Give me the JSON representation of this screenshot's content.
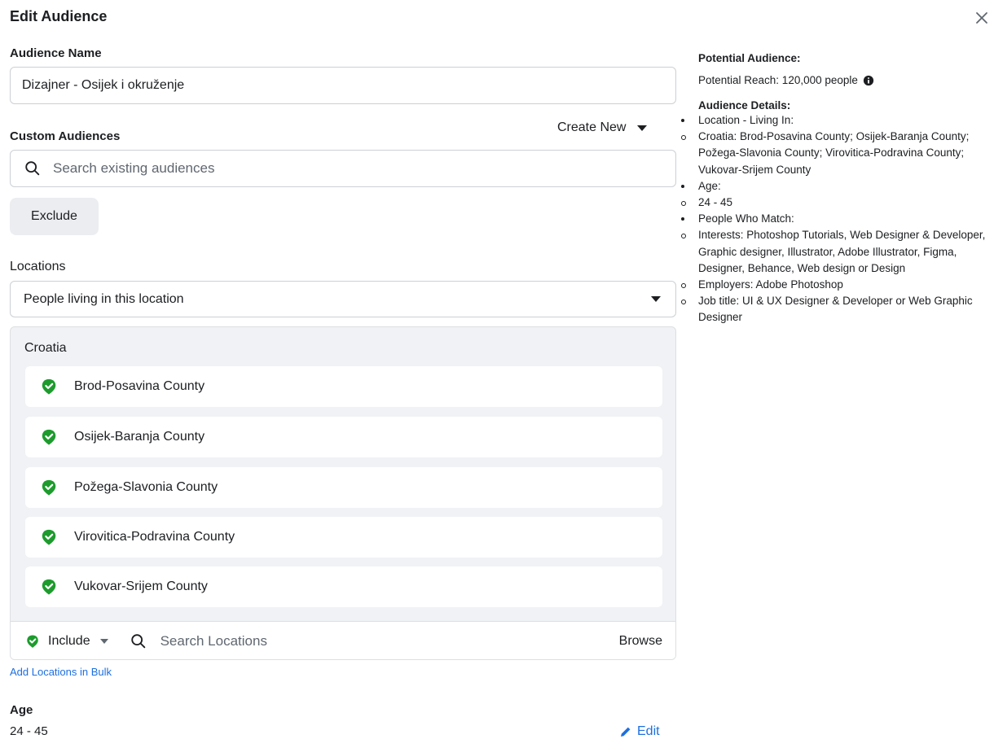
{
  "dialog": {
    "title": "Edit Audience",
    "close_icon": "close-icon"
  },
  "audience_name": {
    "label": "Audience Name",
    "value": "Dizajner - Osijek i okruženje"
  },
  "custom_audiences": {
    "label": "Custom Audiences",
    "create_new": "Create New",
    "search_placeholder": "Search existing audiences",
    "exclude_label": "Exclude"
  },
  "locations": {
    "label": "Locations",
    "selected_mode": "People living in this location",
    "country": "Croatia",
    "items": [
      {
        "name": "Brod-Posavina County"
      },
      {
        "name": "Osijek-Baranja County"
      },
      {
        "name": "Požega-Slavonia County"
      },
      {
        "name": "Virovitica-Podravina County"
      },
      {
        "name": "Vukovar-Srijem County"
      }
    ],
    "include_label": "Include",
    "search_placeholder": "Search Locations",
    "browse_label": "Browse",
    "bulk_link": "Add Locations in Bulk"
  },
  "age": {
    "label": "Age",
    "value": "24 - 45",
    "edit_label": "Edit"
  },
  "summary": {
    "potential_heading": "Potential Audience:",
    "potential_reach": "Potential Reach: 120,000 people",
    "details_heading": "Audience Details:",
    "details": [
      {
        "level": 1,
        "text": "Location - Living In:"
      },
      {
        "level": 2,
        "text": "Croatia: Brod-Posavina County; Osijek-Baranja County; Požega-Slavonia County; Virovitica-Podravina County; Vukovar-Srijem County"
      },
      {
        "level": 1,
        "text": "Age:"
      },
      {
        "level": 2,
        "text": "24 - 45"
      },
      {
        "level": 1,
        "text": "People Who Match:"
      },
      {
        "level": 2,
        "text": "Interests: Photoshop Tutorials, Web Designer & Developer, Graphic designer, Illustrator, Adobe Illustrator, Figma, Designer, Behance, Web design or Design"
      },
      {
        "level": 2,
        "text": "Employers: Adobe Photoshop"
      },
      {
        "level": 2,
        "text": "Job title: UI & UX Designer & Developer or Web Graphic Designer"
      }
    ]
  },
  "colors": {
    "accent": "#1d6fe0",
    "include_green": "#1d9b2d",
    "panel_bg": "#f0f2f5"
  }
}
